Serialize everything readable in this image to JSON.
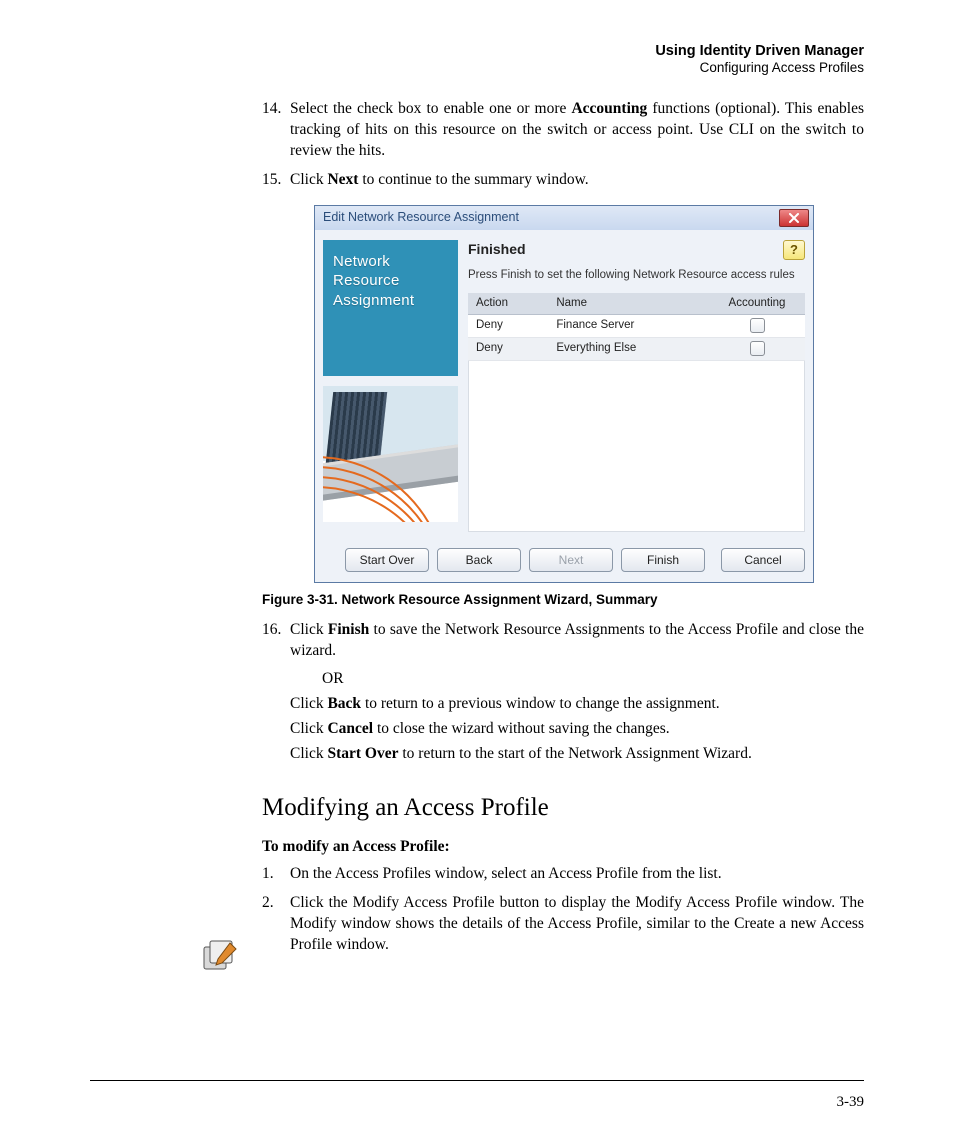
{
  "header": {
    "title": "Using Identity Driven Manager",
    "subtitle": "Configuring Access Profiles"
  },
  "steps": {
    "s14": {
      "num": "14.",
      "pre": "Select the check box to enable one or more ",
      "bold": "Accounting",
      "post": " functions (optional). This enables tracking of hits on this resource on the switch or access point. Use CLI on the switch to review the hits."
    },
    "s15": {
      "num": "15.",
      "pre": "Click ",
      "bold": "Next",
      "post": " to continue to the summary window."
    },
    "s16": {
      "num": "16.",
      "pre": "Click ",
      "bold": "Finish",
      "post": " to save the Network Resource Assignments to the Access Profile and close the wizard."
    }
  },
  "or": "OR",
  "sub1": {
    "pre": "Click ",
    "bold": "Back",
    "post": " to return to a previous window to change the assignment."
  },
  "sub2": {
    "pre": "Click ",
    "bold": "Cancel",
    "post": " to close the wizard without saving the changes."
  },
  "sub3": {
    "pre": "Click ",
    "bold": "Start Over",
    "post": " to return to the start of the Network Assignment Wizard."
  },
  "dialog": {
    "title": "Edit Network Resource Assignment",
    "sideTitle": "Network Resource Assignment",
    "heading": "Finished",
    "desc": "Press Finish to set the following Network Resource access rules",
    "cols": {
      "c1": "Action",
      "c2": "Name",
      "c3": "Accounting"
    },
    "rows": [
      {
        "action": "Deny",
        "name": "Finance Server"
      },
      {
        "action": "Deny",
        "name": "Everything Else"
      }
    ],
    "buttons": {
      "start": "Start Over",
      "back": "Back",
      "next": "Next",
      "finish": "Finish",
      "cancel": "Cancel"
    }
  },
  "caption": "Figure 3-31. Network Resource Assignment Wizard, Summary",
  "section": {
    "heading": "Modifying an Access Profile",
    "sub": "To modify an Access Profile:",
    "p1": {
      "num": "1.",
      "txt": "On the Access Profiles window, select an Access Profile from the list."
    },
    "p2": {
      "num": "2.",
      "txt": "Click the Modify Access Profile button to display the Modify Access Profile window. The Modify window shows the details of the Access Profile, similar to the Create a new Access Profile window."
    }
  },
  "pageno": "3-39"
}
